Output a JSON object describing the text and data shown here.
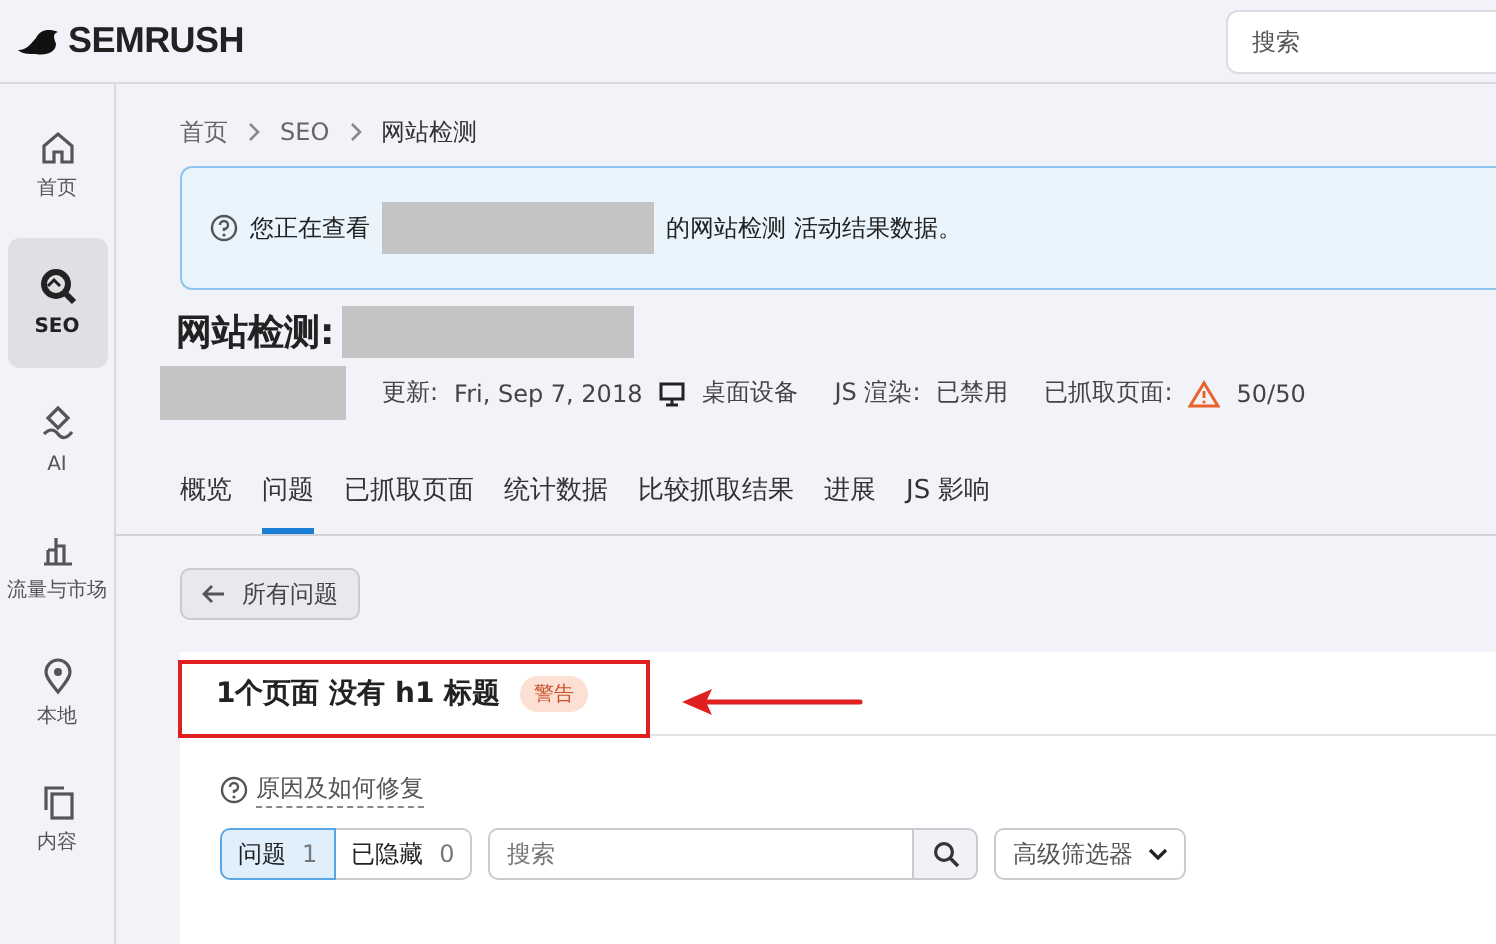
{
  "header": {
    "logo": "SEMRUSH",
    "search": {
      "placeholder": "搜索"
    }
  },
  "sidebar": {
    "items": [
      {
        "label": "首页",
        "selected": false
      },
      {
        "label": "SEO",
        "selected": true
      },
      {
        "label": "AI",
        "selected": false
      },
      {
        "label": "流量与市场",
        "selected": false
      },
      {
        "label": "本地",
        "selected": false
      },
      {
        "label": "内容",
        "selected": false
      }
    ]
  },
  "breadcrumb": [
    "首页",
    "SEO",
    "网站检测"
  ],
  "notice": {
    "before": "您正在查看",
    "after": "的网站检测 活动结果数据。"
  },
  "title": "网站检测:",
  "meta": {
    "updated_label": "更新:",
    "updated": "Fri, Sep 7, 2018",
    "device": "桌面设备",
    "js_label": "JS 渲染:",
    "js": "已禁用",
    "crawled_label": "已抓取页面:",
    "crawled": "50/50"
  },
  "tabs": [
    {
      "label": "概览",
      "selected": false
    },
    {
      "label": "问题",
      "selected": true
    },
    {
      "label": "已抓取页面",
      "selected": false
    },
    {
      "label": "统计数据",
      "selected": false
    },
    {
      "label": "比较抓取结果",
      "selected": false
    },
    {
      "label": "进展",
      "selected": false
    },
    {
      "label": "JS 影响",
      "selected": false
    }
  ],
  "back_button": "所有问题",
  "issue": {
    "title": "1个页面 没有 h1 标题",
    "badge": "警告"
  },
  "help_link": "原因及如何修复",
  "segments": [
    {
      "label": "问题",
      "count": "1",
      "selected": true
    },
    {
      "label": "已隐藏",
      "count": "0",
      "selected": false
    }
  ],
  "filter_search": {
    "placeholder": "搜索"
  },
  "advanced_filter": "高级筛选器"
}
